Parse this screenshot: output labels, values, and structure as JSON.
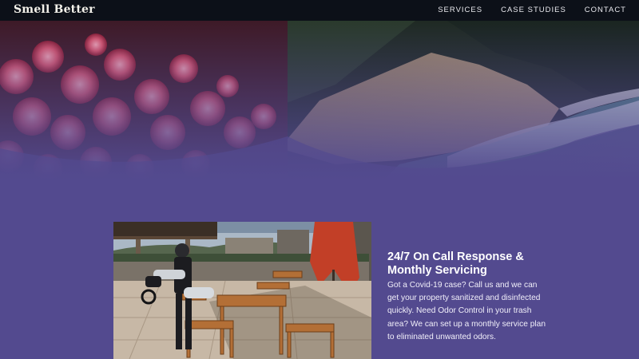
{
  "brand": {
    "name": "Smell Better"
  },
  "nav": {
    "items": [
      {
        "label": "SERVICES"
      },
      {
        "label": "CASE STUDIES"
      },
      {
        "label": "CONTACT"
      }
    ]
  },
  "feature": {
    "heading": "24/7 On Call Response & Monthly Servicing",
    "body": "Got a Covid-19 case? Call us and we can get your property sanitized and disinfected quickly. Need Odor Control in your trash area? We can set up a monthly service plan to eliminated unwanted odors."
  },
  "colors": {
    "page_background": "#534a8f",
    "navbar_background": "#0c1018"
  }
}
